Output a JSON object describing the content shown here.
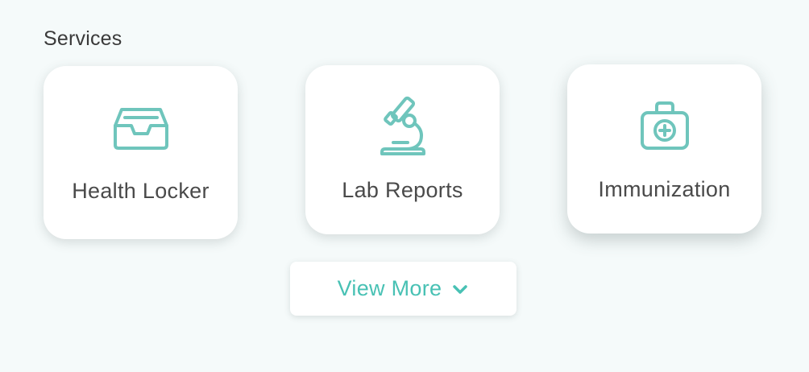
{
  "section": {
    "title": "Services"
  },
  "services": [
    {
      "label": "Health Locker",
      "icon": "inbox-tray-icon"
    },
    {
      "label": "Lab Reports",
      "icon": "microscope-icon"
    },
    {
      "label": "Immunization",
      "icon": "medical-kit-icon"
    }
  ],
  "view_more": {
    "label": "View More",
    "icon": "chevron-down-icon"
  },
  "colors": {
    "accent": "#48c1b4",
    "icon": "#6fc5bc",
    "background": "#f5fafa",
    "text": "#4a4a4a"
  }
}
